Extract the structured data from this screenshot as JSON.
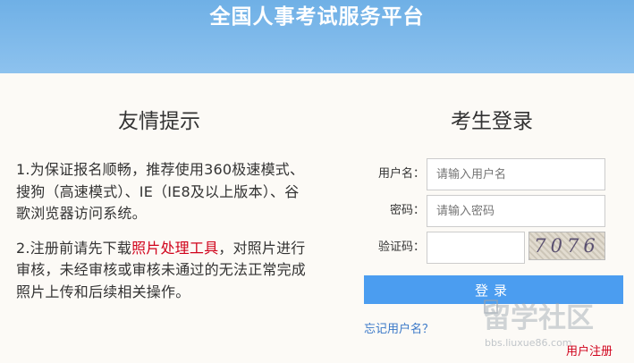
{
  "header": {
    "title": "全国人事考试服务平台"
  },
  "tips": {
    "title": "友情提示",
    "item1": "1.为保证报名顺畅，推荐使用360极速模式、搜狗（高速模式）、IE（IE8及以上版本）、谷歌浏览器访问系统。",
    "item2_prefix": "2.注册前请先下载",
    "item2_link": "照片处理工具",
    "item2_suffix": "，对照片进行审核，未经审核或审核未通过的无法正常完成照片上传和后续相关操作。"
  },
  "login": {
    "title": "考生登录",
    "username_label": "用户名：",
    "username_placeholder": "请输入用户名",
    "password_label": "密码：",
    "password_placeholder": "请输入密码",
    "captcha_label": "验证码：",
    "captcha_text": "7076",
    "submit_label": "登录",
    "forgot_label": "忘记用户名？",
    "register_label": "用户注册"
  },
  "watermark": {
    "text": "留学社区",
    "url": "bbs.liuxue86.com"
  }
}
